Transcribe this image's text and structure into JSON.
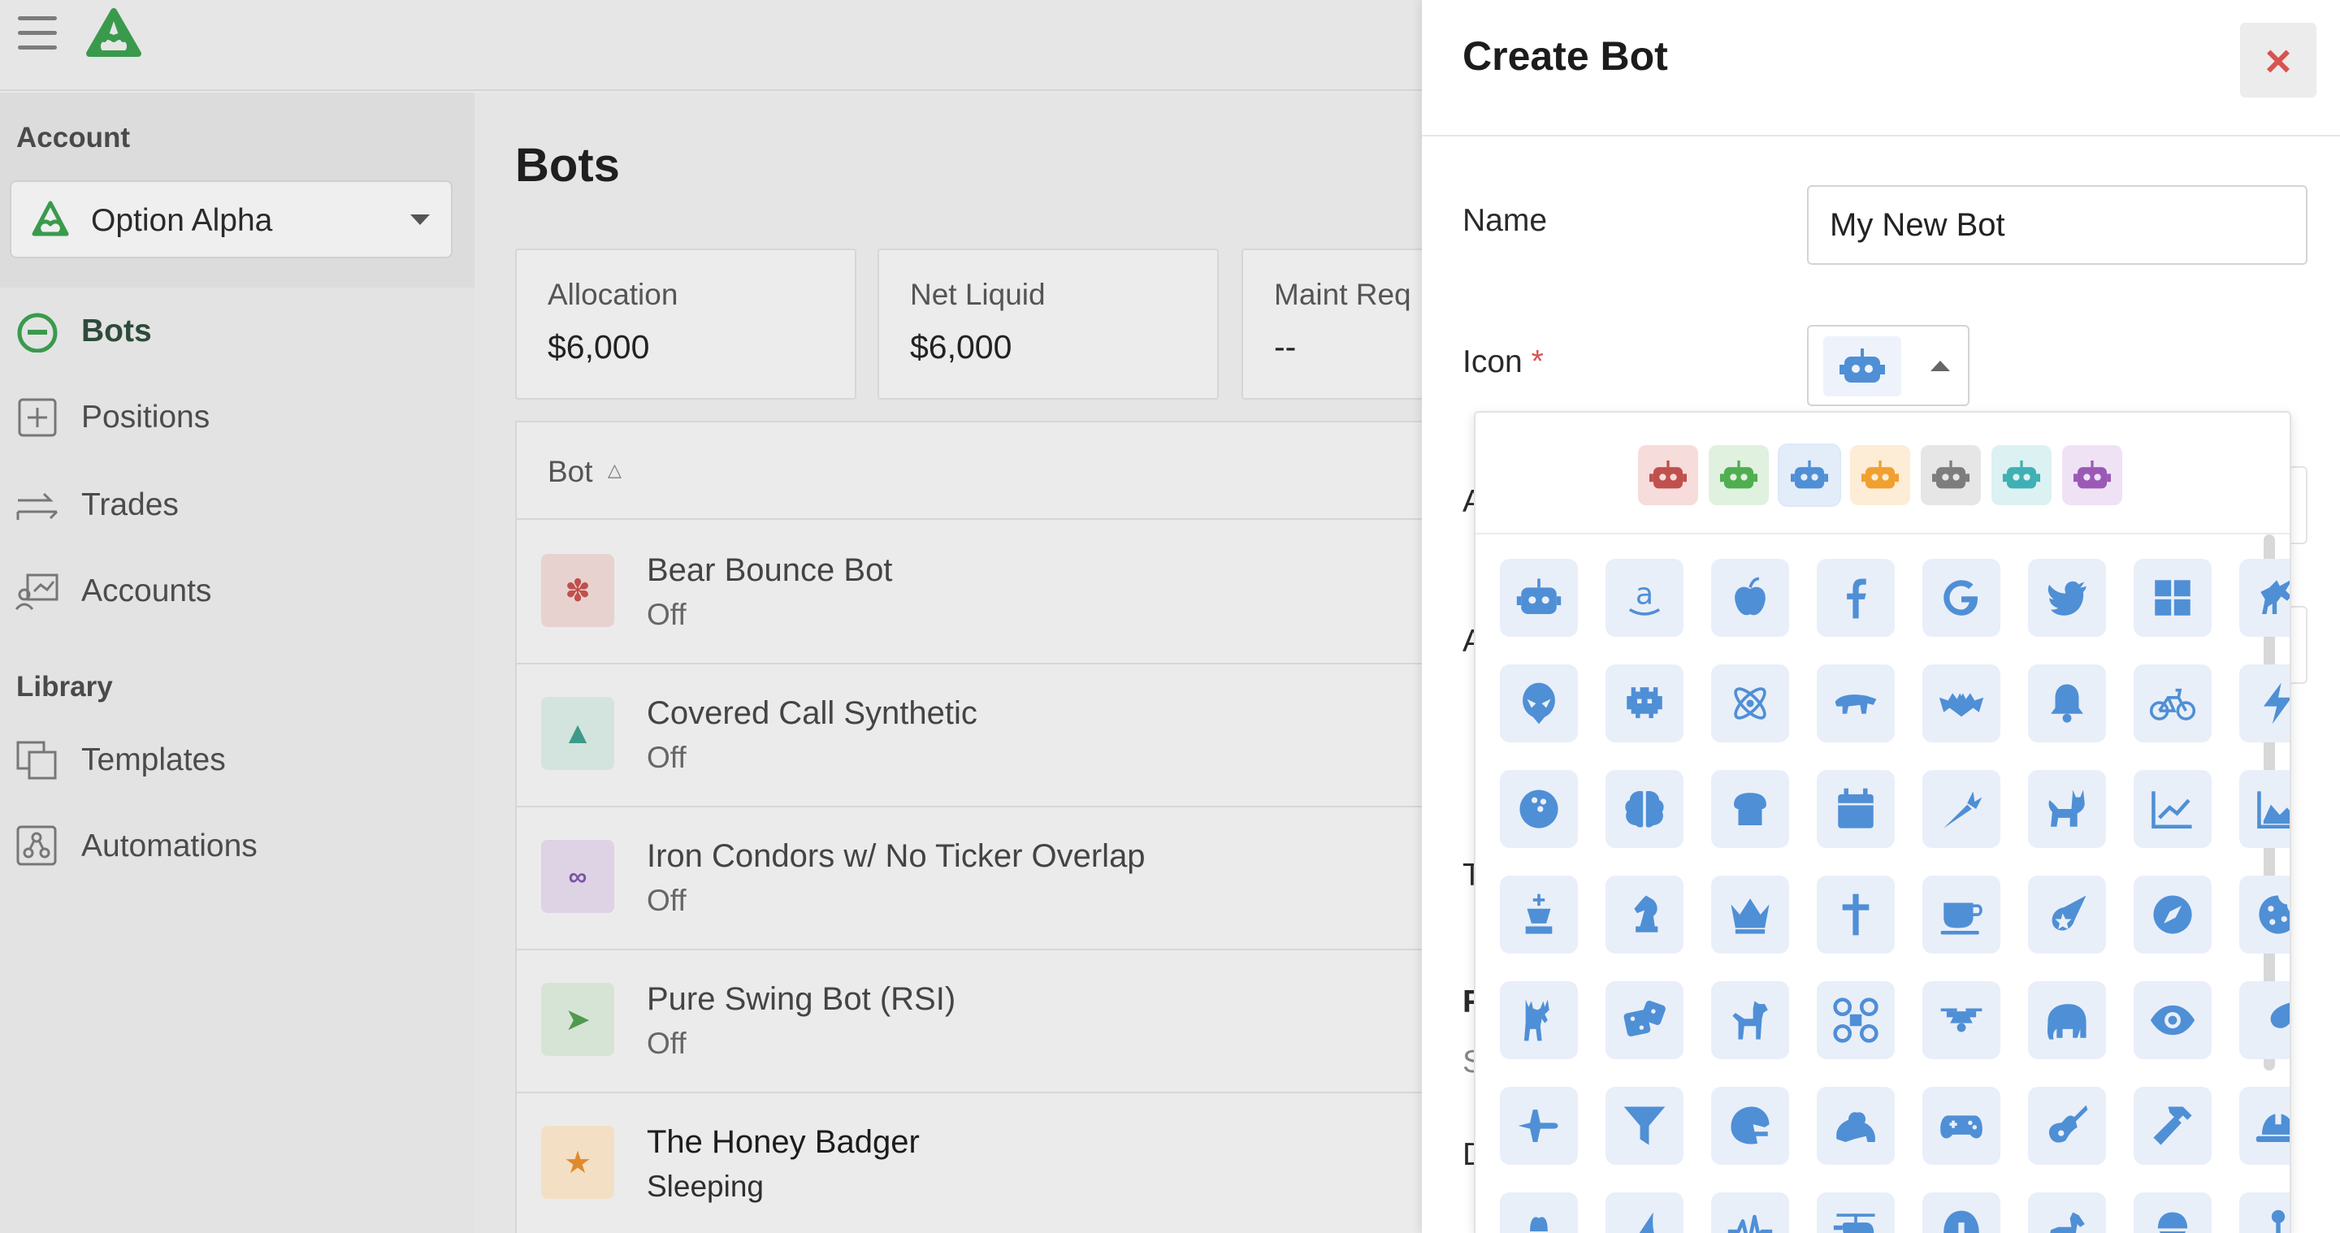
{
  "sidebar": {
    "account_section": "Account",
    "account_name": "Option Alpha",
    "library_section": "Library",
    "items": [
      {
        "label": "Bots",
        "icon": "bots-icon"
      },
      {
        "label": "Positions",
        "icon": "positions-icon"
      },
      {
        "label": "Trades",
        "icon": "trades-icon"
      },
      {
        "label": "Accounts",
        "icon": "accounts-icon"
      }
    ],
    "library_items": [
      {
        "label": "Templates",
        "icon": "templates-icon"
      },
      {
        "label": "Automations",
        "icon": "automations-icon"
      }
    ]
  },
  "main": {
    "title": "Bots",
    "stats": [
      {
        "label": "Allocation",
        "value": "$6,000"
      },
      {
        "label": "Net Liquid",
        "value": "$6,000"
      },
      {
        "label": "Maint Req",
        "value": "--"
      }
    ],
    "table": {
      "column": "Bot",
      "rows": [
        {
          "name": "Bear Bounce Bot",
          "status": "Off",
          "icon": "paw-icon",
          "color": "#e8b9b3",
          "fg": "#c0504d"
        },
        {
          "name": "Covered Call Synthetic",
          "status": "Off",
          "icon": "shark-fin-icon",
          "color": "#bfe0d8",
          "fg": "#3d9a8b"
        },
        {
          "name": "Iron Condors w/ No Ticker Overlap",
          "status": "Off",
          "icon": "infinity-icon",
          "color": "#d9c8e4",
          "fg": "#7b54a8"
        },
        {
          "name": "Pure Swing Bot (RSI)",
          "status": "Off",
          "icon": "carrot-icon",
          "color": "#cfe3cf",
          "fg": "#4f9a4f"
        },
        {
          "name": "The Honey Badger",
          "status": "Sleeping",
          "icon": "badger-icon",
          "color": "#f3d9b8",
          "fg": "#e08a2e"
        }
      ]
    }
  },
  "modal": {
    "title": "Create Bot",
    "close_label": "×",
    "name_label": "Name",
    "name_value": "My New Bot",
    "icon_label": "Icon",
    "required_mark": "*",
    "partial_labels": [
      "A",
      "A",
      "T",
      "F",
      "S",
      "D"
    ]
  },
  "picker": {
    "colors": [
      "#c0504d",
      "#4fae4f",
      "#4f8fd6",
      "#f0a030",
      "#7d7d7d",
      "#3fb0b5",
      "#9b59b6"
    ],
    "swatch_bgs": [
      "#f6dcda",
      "#e0f1e0",
      "#e3edf9",
      "#fdecd6",
      "#e6e6e6",
      "#dcf1f2",
      "#efe2f5"
    ],
    "icons": [
      "robot-icon",
      "amazon-icon",
      "apple-icon",
      "facebook-icon",
      "google-icon",
      "twitter-icon",
      "windows-icon",
      "unicorn-icon",
      "alien-icon",
      "space-invader-icon",
      "atom-icon",
      "badger-icon",
      "bat-icon",
      "bell-icon",
      "bicycle-icon",
      "bolt-icon",
      "bowling-ball-icon",
      "brain-icon",
      "bread-icon",
      "calendar-icon",
      "carrot-icon",
      "cat-icon",
      "chart-up-icon",
      "chart-area-icon",
      "chess-king-icon",
      "chess-knight-icon",
      "crown-icon",
      "cross-icon",
      "coffee-icon",
      "comet-icon",
      "compass-icon",
      "cookie-icon",
      "deer-icon",
      "dice-icon",
      "dog-icon",
      "drone-icon",
      "drone-alt-icon",
      "elephant-icon",
      "eye-icon",
      "feather-icon",
      "plane-icon",
      "filter-icon",
      "football-helmet-icon",
      "frog-icon",
      "gamepad-icon",
      "guitar-icon",
      "hammer-icon",
      "hard-hat-icon",
      "cowboy-hat-icon",
      "shark-fin-icon",
      "heartbeat-icon",
      "helicopter-icon",
      "helmet-icon",
      "horse-icon",
      "ice-cream-icon",
      "joystick-icon"
    ]
  }
}
